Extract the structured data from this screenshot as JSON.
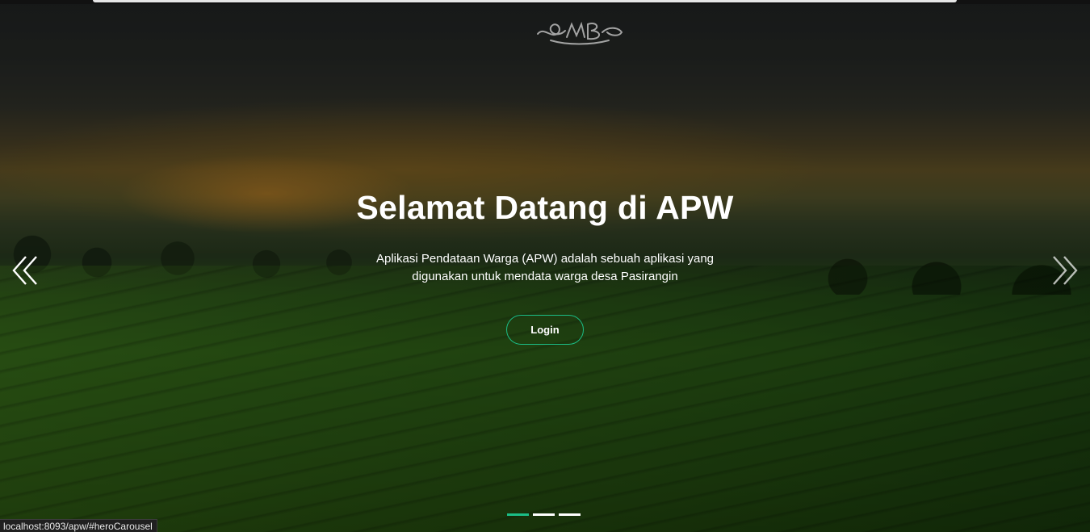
{
  "hero": {
    "title": "Selamat Datang di APW",
    "description": "Aplikasi Pendataan Warga (APW) adalah sebuah aplikasi yang digunakan untuk mendata warga desa Pasirangin",
    "login_label": "Login"
  },
  "carousel": {
    "prev_icon": "double-chevron-left-icon",
    "next_icon": "double-chevron-right-icon",
    "slide_count": 3,
    "active_index": 0
  },
  "status_bar": {
    "url": "localhost:8093/apw/#heroCarousel"
  },
  "colors": {
    "accent": "#1bbd86",
    "text": "#ffffff"
  }
}
